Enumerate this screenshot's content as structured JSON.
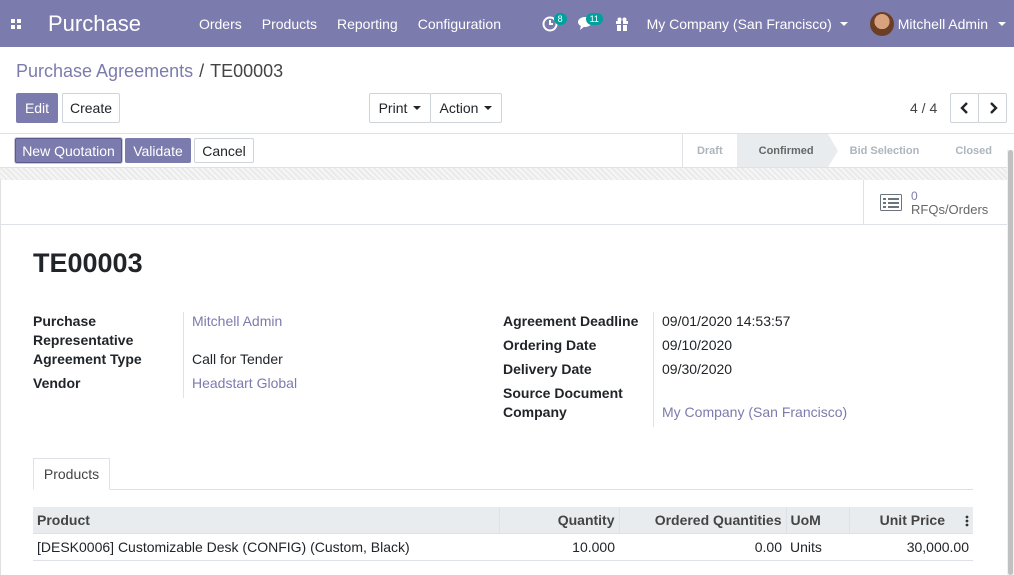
{
  "navbar": {
    "brand": "Purchase",
    "menu": [
      "Orders",
      "Products",
      "Reporting",
      "Configuration"
    ],
    "activity_count": "8",
    "messages_count": "11",
    "company": "My Company (San Francisco)",
    "user": "Mitchell Admin"
  },
  "breadcrumb": {
    "parent": "Purchase Agreements",
    "separator": "/",
    "current": "TE00003"
  },
  "control": {
    "edit": "Edit",
    "create": "Create",
    "print": "Print",
    "action": "Action",
    "pager": "4 / 4"
  },
  "header_buttons": {
    "new_quotation": "New Quotation",
    "validate": "Validate",
    "cancel": "Cancel"
  },
  "statusbar": {
    "stages": [
      "Draft",
      "Confirmed",
      "Bid Selection",
      "Closed"
    ],
    "active": "Confirmed"
  },
  "stat_button": {
    "value": "0",
    "label": "RFQs/Orders"
  },
  "record": {
    "name": "TE00003",
    "left": {
      "purchase_rep_label_1": "Purchase",
      "purchase_rep_label_2": "Representative",
      "purchase_rep": "Mitchell Admin",
      "agreement_type_label": "Agreement Type",
      "agreement_type": "Call for Tender",
      "vendor_label": "Vendor",
      "vendor": "Headstart Global"
    },
    "right": {
      "deadline_label": "Agreement Deadline",
      "deadline": "09/01/2020 14:53:57",
      "ordering_label": "Ordering Date",
      "ordering": "09/10/2020",
      "delivery_label": "Delivery Date",
      "delivery": "09/30/2020",
      "source_label": "Source Document",
      "source": "",
      "company_label": "Company",
      "company": "My Company (San Francisco)"
    }
  },
  "tabs": {
    "products": "Products"
  },
  "lines": {
    "headers": [
      "Product",
      "Quantity",
      "Ordered Quantities",
      "UoM",
      "Unit Price"
    ],
    "rows": [
      {
        "product": "[DESK0006] Customizable Desk (CONFIG) (Custom, Black)",
        "quantity": "10.000",
        "ordered": "0.00",
        "uom": "Units",
        "price": "30,000.00"
      }
    ]
  }
}
